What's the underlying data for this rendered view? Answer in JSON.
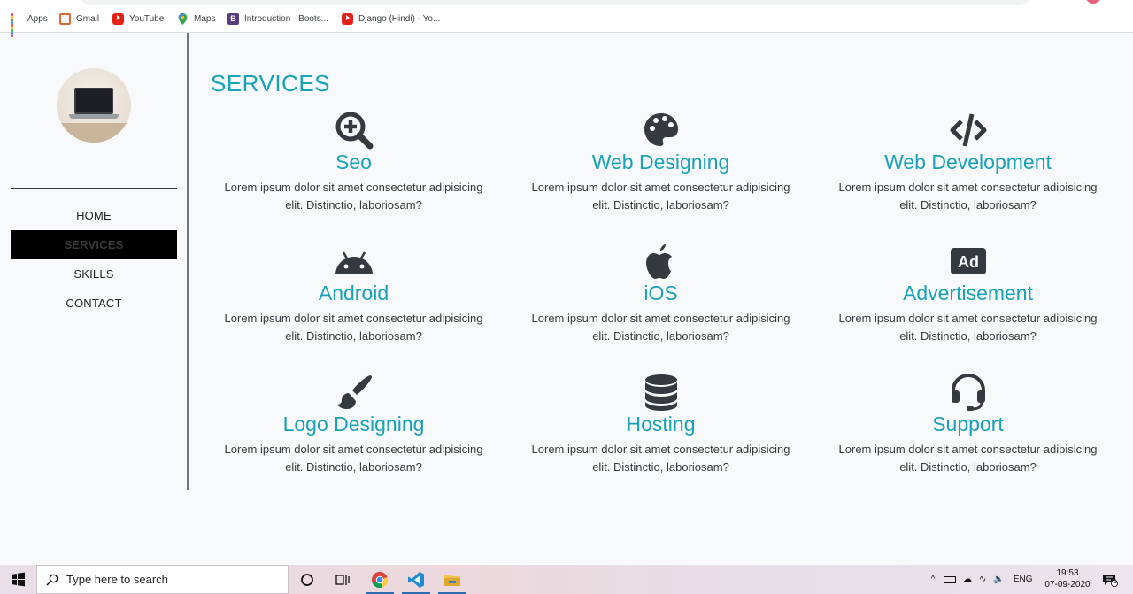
{
  "bookmarks": [
    {
      "label": "Apps",
      "icon": "apps-grid-icon"
    },
    {
      "label": "Gmail",
      "icon": "gmail-icon"
    },
    {
      "label": "YouTube",
      "icon": "youtube-icon"
    },
    {
      "label": "Maps",
      "icon": "maps-pin-icon"
    },
    {
      "label": "Introduction · Boots...",
      "icon": "bootstrap-icon"
    },
    {
      "label": "Django (Hindi) - Yo...",
      "icon": "youtube-icon"
    }
  ],
  "sidebar": {
    "nav": [
      {
        "label": "HOME"
      },
      {
        "label": "SERVICES",
        "active": true
      },
      {
        "label": "SKILLS"
      },
      {
        "label": "CONTACT"
      }
    ]
  },
  "main": {
    "title": "SERVICES",
    "services": [
      {
        "title": "Seo",
        "icon": "search-plus-icon",
        "text": "Lorem ipsum dolor sit amet consectetur adipisicing elit. Distinctio, laboriosam?"
      },
      {
        "title": "Web Designing",
        "icon": "palette-icon",
        "text": "Lorem ipsum dolor sit amet consectetur adipisicing elit. Distinctio, laboriosam?"
      },
      {
        "title": "Web Development",
        "icon": "code-icon",
        "text": "Lorem ipsum dolor sit amet consectetur adipisicing elit. Distinctio, laboriosam?"
      },
      {
        "title": "Android",
        "icon": "android-icon",
        "text": "Lorem ipsum dolor sit amet consectetur adipisicing elit. Distinctio, laboriosam?"
      },
      {
        "title": "iOS",
        "icon": "apple-icon",
        "text": "Lorem ipsum dolor sit amet consectetur adipisicing elit. Distinctio, laboriosam?"
      },
      {
        "title": "Advertisement",
        "icon": "ad-icon",
        "text": "Lorem ipsum dolor sit amet consectetur adipisicing elit. Distinctio, laboriosam?"
      },
      {
        "title": "Logo Designing",
        "icon": "paint-brush-icon",
        "text": "Lorem ipsum dolor sit amet consectetur adipisicing elit. Distinctio, laboriosam?"
      },
      {
        "title": "Hosting",
        "icon": "database-icon",
        "text": "Lorem ipsum dolor sit amet consectetur adipisicing elit. Distinctio, laboriosam?"
      },
      {
        "title": "Support",
        "icon": "headset-icon",
        "text": "Lorem ipsum dolor sit amet consectetur adipisicing elit. Distinctio, laboriosam?"
      }
    ]
  },
  "taskbar": {
    "search_placeholder": "Type here to search",
    "language": "ENG",
    "time": "19:53",
    "date": "07-09-2020",
    "notification_count": "1"
  },
  "colors": {
    "accent": "#17a2b8",
    "icon": "#343a40",
    "active_nav_bg": "#000000",
    "page_bg": "#f8f9fa"
  }
}
